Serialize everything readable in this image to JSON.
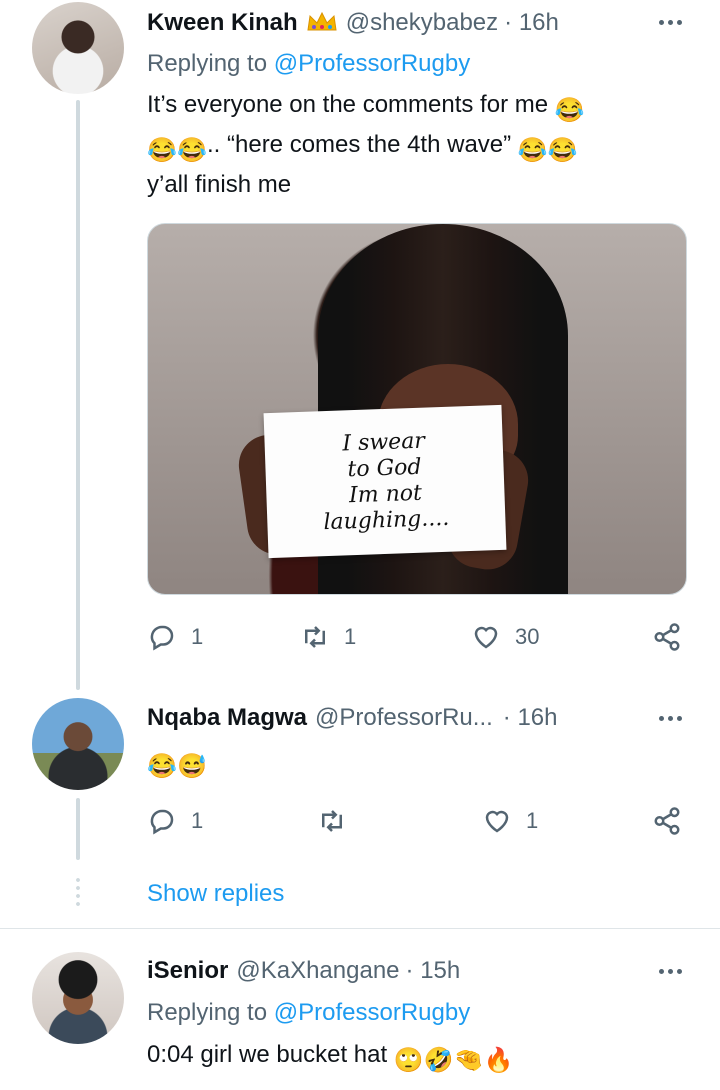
{
  "tweets": [
    {
      "name": "Kween Kinah",
      "handle": "@shekybabez",
      "time": "· 16h",
      "replying_prefix": "Replying to",
      "replying_to": "@ProfessorRugby",
      "text_line1": "It’s everyone on the comments for me",
      "text_line2": ".. “here comes the 4th wave”",
      "text_line3": "y’all finish me",
      "media_text": [
        "I swear",
        "to God",
        "Im not",
        "laughing...."
      ],
      "actions": {
        "replies": "1",
        "retweets": "1",
        "likes": "30"
      },
      "emoji": [
        "face-with-tears-of-joy",
        "face-with-tears-of-joy",
        "face-with-tears-of-joy",
        "face-with-tears-of-joy",
        "face-with-tears-of-joy"
      ],
      "badge_icon": "crown-icon"
    },
    {
      "name": "Nqaba Magwa",
      "handle": "@ProfessorRu...",
      "time": "· 16h",
      "emoji": [
        "face-with-tears-of-joy",
        "grinning-face-with-sweat"
      ],
      "actions": {
        "replies": "1",
        "retweets": "",
        "likes": "1"
      }
    },
    {
      "name": "iSenior",
      "handle": "@KaXhangane",
      "time": "· 15h",
      "replying_prefix": "Replying to",
      "replying_to": "@ProfessorRugby",
      "text": "0:04 girl we bucket hat",
      "emoji": [
        "face-with-rolling-eyes",
        "rolling-on-the-floor-laughing",
        "pinching-hand",
        "fire"
      ]
    }
  ],
  "show_replies": "Show replies",
  "colors": {
    "link": "#1d9bf0",
    "muted": "#536471",
    "text": "#0f1419",
    "thread": "#cfd9de"
  }
}
